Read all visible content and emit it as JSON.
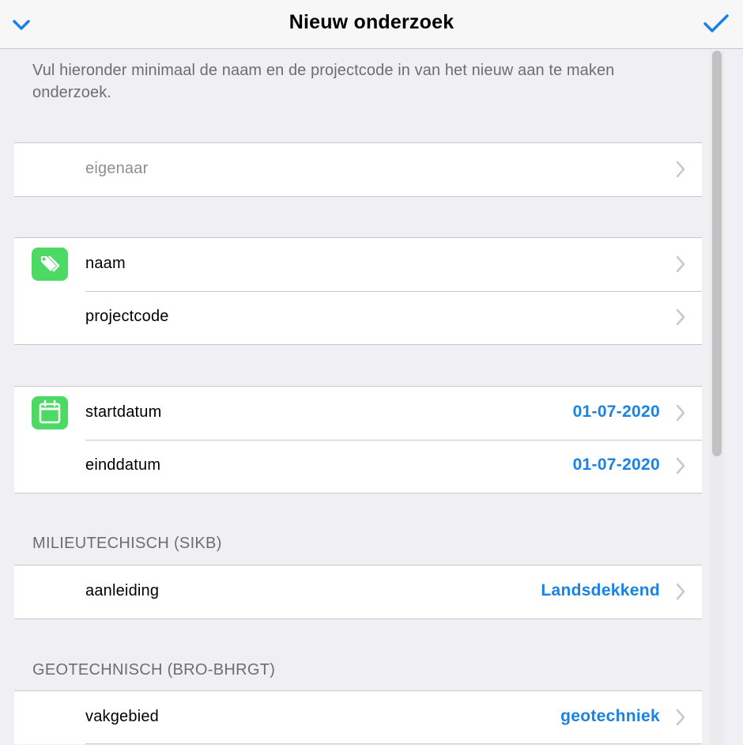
{
  "navbar": {
    "title": "Nieuw onderzoek",
    "left_icon": "chevron-down-icon",
    "right_icon": "checkmark-icon",
    "accent": "#1a82e2"
  },
  "intro": "Vul hieronder minimaal de naam en de projectcode in van het nieuw aan te maken onderzoek.",
  "groups": {
    "owner": {
      "rows": [
        {
          "label": "eigenaar"
        }
      ]
    },
    "identity": {
      "icon": "tag-icon",
      "rows": [
        {
          "label": "naam"
        },
        {
          "label": "projectcode"
        }
      ]
    },
    "dates": {
      "icon": "calendar-icon",
      "rows": [
        {
          "label": "startdatum",
          "value": "01-07-2020"
        },
        {
          "label": "einddatum",
          "value": "01-07-2020"
        }
      ]
    },
    "environmental": {
      "header": "MILIEUTECHISCH (SIKB)",
      "rows": [
        {
          "label": "aanleiding",
          "value": "Landsdekkend"
        }
      ]
    },
    "geotechnical": {
      "header": "GEOTECHNISCH (BRO-BHRGT)",
      "rows": [
        {
          "label": "vakgebied",
          "value": "geotechniek"
        }
      ]
    }
  },
  "colors": {
    "icon_green": "#4cd964",
    "value_blue": "#1a82e2",
    "background": "#efeff4"
  }
}
